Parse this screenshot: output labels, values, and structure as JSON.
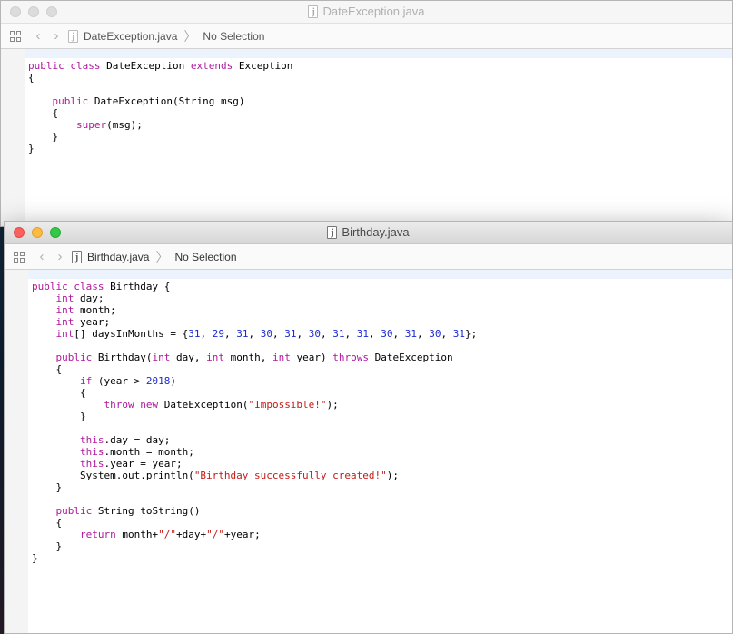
{
  "back_window": {
    "title": "DateException.java",
    "jump_file": "DateException.java",
    "jump_selection": "No Selection",
    "code": [
      [
        [
          "kw",
          "public"
        ],
        [
          "p",
          " "
        ],
        [
          "kw",
          "class"
        ],
        [
          "p",
          " DateException "
        ],
        [
          "kw",
          "extends"
        ],
        [
          "p",
          " Exception"
        ]
      ],
      [
        [
          "p",
          "{"
        ]
      ],
      [],
      [
        [
          "p",
          "    "
        ],
        [
          "kw",
          "public"
        ],
        [
          "p",
          " DateException(String msg)"
        ]
      ],
      [
        [
          "p",
          "    {"
        ]
      ],
      [
        [
          "p",
          "        "
        ],
        [
          "kw",
          "super"
        ],
        [
          "p",
          "(msg);"
        ]
      ],
      [
        [
          "p",
          "    }"
        ]
      ],
      [
        [
          "p",
          "}"
        ]
      ]
    ]
  },
  "front_window": {
    "title": "Birthday.java",
    "jump_file": "Birthday.java",
    "jump_selection": "No Selection",
    "code": [
      [
        [
          "kw",
          "public"
        ],
        [
          "p",
          " "
        ],
        [
          "kw",
          "class"
        ],
        [
          "p",
          " Birthday {"
        ]
      ],
      [
        [
          "p",
          "    "
        ],
        [
          "kw",
          "int"
        ],
        [
          "p",
          " day;"
        ]
      ],
      [
        [
          "p",
          "    "
        ],
        [
          "kw",
          "int"
        ],
        [
          "p",
          " month;"
        ]
      ],
      [
        [
          "p",
          "    "
        ],
        [
          "kw",
          "int"
        ],
        [
          "p",
          " year;"
        ]
      ],
      [
        [
          "p",
          "    "
        ],
        [
          "kw",
          "int"
        ],
        [
          "p",
          "[] daysInMonths = {"
        ],
        [
          "num",
          "31"
        ],
        [
          "p",
          ", "
        ],
        [
          "num",
          "29"
        ],
        [
          "p",
          ", "
        ],
        [
          "num",
          "31"
        ],
        [
          "p",
          ", "
        ],
        [
          "num",
          "30"
        ],
        [
          "p",
          ", "
        ],
        [
          "num",
          "31"
        ],
        [
          "p",
          ", "
        ],
        [
          "num",
          "30"
        ],
        [
          "p",
          ", "
        ],
        [
          "num",
          "31"
        ],
        [
          "p",
          ", "
        ],
        [
          "num",
          "31"
        ],
        [
          "p",
          ", "
        ],
        [
          "num",
          "30"
        ],
        [
          "p",
          ", "
        ],
        [
          "num",
          "31"
        ],
        [
          "p",
          ", "
        ],
        [
          "num",
          "30"
        ],
        [
          "p",
          ", "
        ],
        [
          "num",
          "31"
        ],
        [
          "p",
          "};"
        ]
      ],
      [],
      [
        [
          "p",
          "    "
        ],
        [
          "kw",
          "public"
        ],
        [
          "p",
          " Birthday("
        ],
        [
          "kw",
          "int"
        ],
        [
          "p",
          " day, "
        ],
        [
          "kw",
          "int"
        ],
        [
          "p",
          " month, "
        ],
        [
          "kw",
          "int"
        ],
        [
          "p",
          " year) "
        ],
        [
          "kw",
          "throws"
        ],
        [
          "p",
          " DateException"
        ]
      ],
      [
        [
          "p",
          "    {"
        ]
      ],
      [
        [
          "p",
          "        "
        ],
        [
          "kw",
          "if"
        ],
        [
          "p",
          " (year > "
        ],
        [
          "num",
          "2018"
        ],
        [
          "p",
          ")"
        ]
      ],
      [
        [
          "p",
          "        {"
        ]
      ],
      [
        [
          "p",
          "            "
        ],
        [
          "kw",
          "throw"
        ],
        [
          "p",
          " "
        ],
        [
          "kw",
          "new"
        ],
        [
          "p",
          " DateException("
        ],
        [
          "str",
          "\"Impossible!\""
        ],
        [
          "p",
          ");"
        ]
      ],
      [
        [
          "p",
          "        }"
        ]
      ],
      [],
      [
        [
          "p",
          "        "
        ],
        [
          "kw",
          "this"
        ],
        [
          "p",
          ".day = day;"
        ]
      ],
      [
        [
          "p",
          "        "
        ],
        [
          "kw",
          "this"
        ],
        [
          "p",
          ".month = month;"
        ]
      ],
      [
        [
          "p",
          "        "
        ],
        [
          "kw",
          "this"
        ],
        [
          "p",
          ".year = year;"
        ]
      ],
      [
        [
          "p",
          "        System.out.println("
        ],
        [
          "str",
          "\"Birthday successfully created!\""
        ],
        [
          "p",
          ");"
        ]
      ],
      [
        [
          "p",
          "    }"
        ]
      ],
      [],
      [
        [
          "p",
          "    "
        ],
        [
          "kw",
          "public"
        ],
        [
          "p",
          " String toString()"
        ]
      ],
      [
        [
          "p",
          "    {"
        ]
      ],
      [
        [
          "p",
          "        "
        ],
        [
          "kw",
          "return"
        ],
        [
          "p",
          " month+"
        ],
        [
          "str",
          "\"/\""
        ],
        [
          "p",
          "+day+"
        ],
        [
          "str",
          "\"/\""
        ],
        [
          "p",
          "+year;"
        ]
      ],
      [
        [
          "p",
          "    }"
        ]
      ],
      [
        [
          "p",
          "}"
        ]
      ]
    ]
  }
}
